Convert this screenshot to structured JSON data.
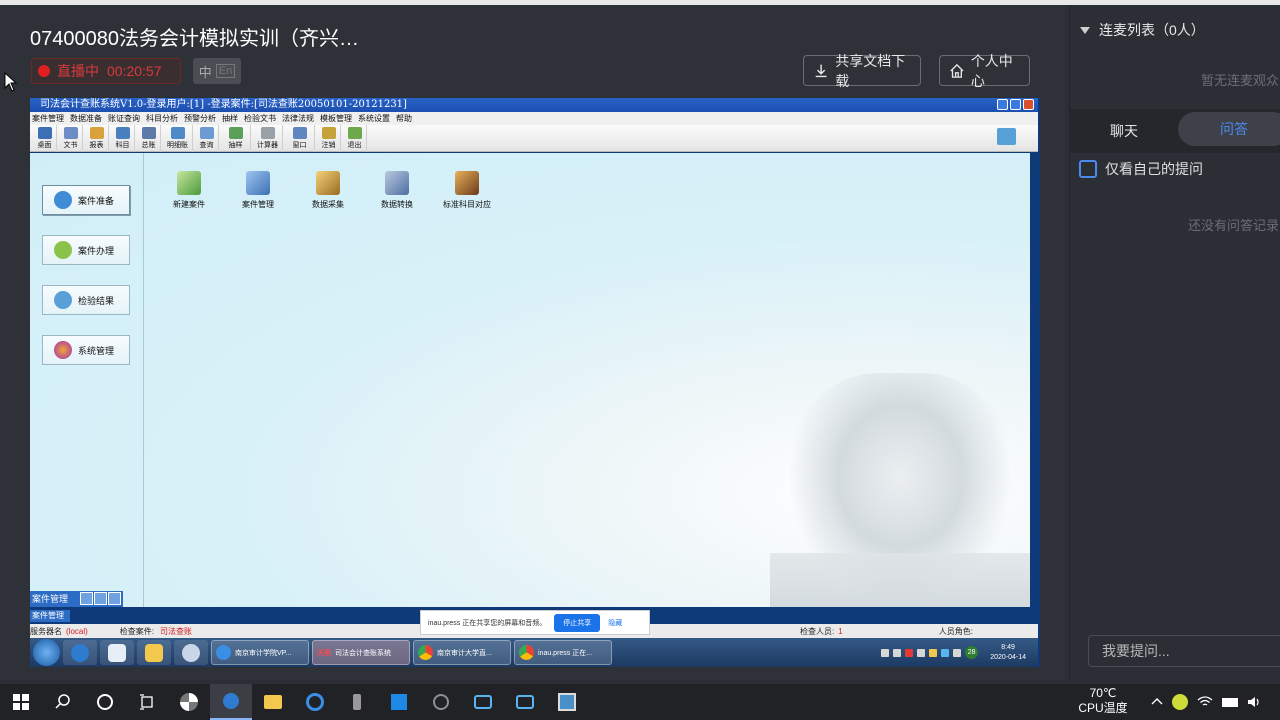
{
  "stream": {
    "title": "07400080法务会计模拟实训（齐兴…",
    "live_label": "直播中",
    "live_timer": "00:20:57",
    "lang_zh": "中",
    "lang_en": "En",
    "download_btn": "共享文档下载",
    "profile_btn": "个人中心"
  },
  "app": {
    "window_title": "司法会计查账系统V1.0-登录用户:[1] -登录案件:[司法查账20050101-20121231]",
    "menu": [
      "案件管理",
      "数据准备",
      "账证查询",
      "科目分析",
      "预警分析",
      "抽样",
      "检验文书",
      "法律法规",
      "模板管理",
      "系统设置",
      "帮助"
    ],
    "toolbar": [
      "桌面",
      "文书",
      "报表",
      "科目",
      "总账",
      "明细账",
      "查询",
      "抽样",
      "计算器",
      "窗口",
      "注销",
      "退出"
    ],
    "nav": [
      "案件准备",
      "案件办理",
      "检验结果",
      "系统管理"
    ],
    "features": [
      "新建案件",
      "案件管理",
      "数据采集",
      "数据转换",
      "标准科目对应"
    ],
    "subpanel_title": "案件管理",
    "subpanel_tab": "案件管理",
    "status": {
      "server_label": "服务器名",
      "server_value": "(local)",
      "case_label": "检查案件:",
      "case_value": "司法查账",
      "inspector_label": "检查人员:",
      "inspector_value": "1",
      "role_label": "人员角色:"
    },
    "share_notice": {
      "text": "inau.press 正在共享您的屏幕和音频。",
      "stop": "停止共享",
      "hide": "隐藏"
    },
    "win7_tasks": [
      "南京审计学院VP...",
      "司法会计查账系统",
      "南京审计大学直...",
      "inau.press 正在..."
    ],
    "win7_task_prefix": "天用",
    "win7_clock_time": "8:49",
    "win7_clock_date": "2020-04-14",
    "win7_tray_badge": "28"
  },
  "panel": {
    "mic_list": "连麦列表（0人）",
    "mic_empty": "暂无连麦观众",
    "tab_chat": "聊天",
    "tab_qa": "问答",
    "own_only": "仅看自己的提问",
    "qa_empty": "还没有问答记录",
    "ask_placeholder": "我要提问..."
  },
  "host": {
    "cpu_temp": "70℃",
    "cpu_label": "CPU温度"
  },
  "colors": {
    "accent": "#4b8bf0",
    "live_red": "#e02020",
    "app_bg": "#d7f1f8"
  }
}
